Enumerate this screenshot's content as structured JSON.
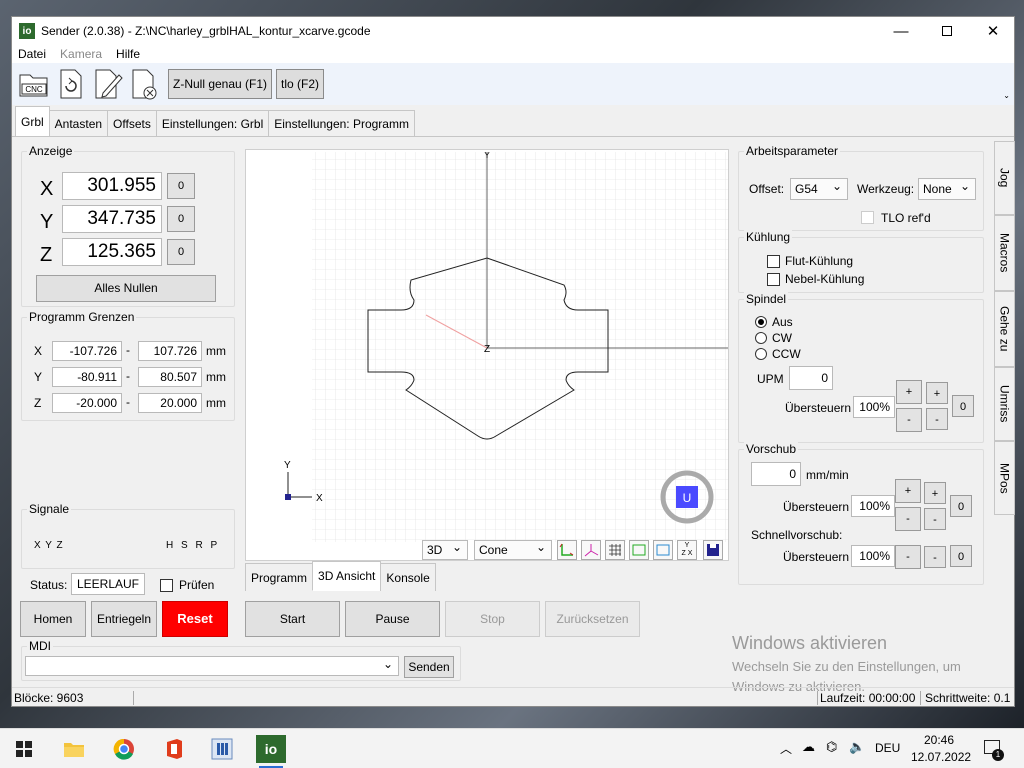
{
  "window": {
    "title": "Sender (2.0.38) - Z:\\NC\\harley_grblHAL_kontur_xcarve.gcode",
    "app_icon": "io"
  },
  "menu": {
    "items": [
      "Datei",
      "Kamera",
      "Hilfe"
    ]
  },
  "toolbar": {
    "zero_btn": "Z-Null genau (F1)",
    "tlo_btn": "tlo (F2)",
    "cnc_label": "CNC"
  },
  "tabs": [
    "Grbl",
    "Antasten",
    "Offsets",
    "Einstellungen: Grbl",
    "Einstellungen: Programm"
  ],
  "display": {
    "title": "Anzeige",
    "x_label": "X",
    "x_value": "301.955",
    "y_label": "Y",
    "y_value": "347.735",
    "z_label": "Z",
    "z_value": "125.365",
    "zero_btn": "0",
    "all_zero": "Alles Nullen"
  },
  "limits": {
    "title": "Programm Grenzen",
    "rows": [
      {
        "axis": "X",
        "min": "-107.726",
        "max": "107.726",
        "unit": "mm"
      },
      {
        "axis": "Y",
        "min": "-80.911",
        "max": "80.507",
        "unit": "mm"
      },
      {
        "axis": "Z",
        "min": "-20.000",
        "max": "20.000",
        "unit": "mm"
      }
    ],
    "dash": "-"
  },
  "signals": {
    "title": "Signale",
    "left": "X Y Z",
    "right": "H S R P"
  },
  "status": {
    "label": "Status:",
    "value": "LEERLAUF",
    "check_label": "Prüfen"
  },
  "buttons": {
    "home": "Homen",
    "unlock": "Entriegeln",
    "reset": "Reset",
    "start": "Start",
    "pause": "Pause",
    "stop": "Stop",
    "rewind": "Zurücksetzen"
  },
  "mdi": {
    "title": "MDI",
    "send": "Senden"
  },
  "view": {
    "mode": "3D",
    "tool_shape": "Cone",
    "axis_y": "Y",
    "axis_x": "X",
    "origin": "Z",
    "top_mark": "Y",
    "icon_yzx_top": "Y",
    "icon_yzx_bottom": "Z X",
    "bottom_tabs": [
      "Programm",
      "3D Ansicht",
      "Konsole"
    ],
    "widget": "U"
  },
  "work": {
    "title": "Arbeitsparameter",
    "offset_label": "Offset:",
    "offset_value": "G54",
    "tool_label": "Werkzeug:",
    "tool_value": "None",
    "tlo": "TLO ref'd"
  },
  "coolant": {
    "title": "Kühlung",
    "flood": "Flut-Kühlung",
    "mist": "Nebel-Kühlung"
  },
  "spindle": {
    "title": "Spindel",
    "off": "Aus",
    "cw": "CW",
    "ccw": "CCW",
    "rpm_label": "UPM",
    "rpm_value": "0",
    "override_label": "Übersteuern",
    "override_value": "100%",
    "plus": "+",
    "minus": "-",
    "zero": "0"
  },
  "feed": {
    "title": "Vorschub",
    "value": "0",
    "unit": "mm/min",
    "override_label": "Übersteuern",
    "override_value": "100%",
    "rapid_label": "Schnellvorschub:",
    "rapid_override_label": "Übersteuern",
    "rapid_value": "100%",
    "plus": "+",
    "minus": "-",
    "zero": "0"
  },
  "side_tabs": [
    "Jog",
    "Macros",
    "Gehe zu",
    "Umriss",
    "MPos"
  ],
  "statusbar": {
    "blocks": "Blöcke: 9603",
    "runtime": "Laufzeit: 00:00:00",
    "step": "Schrittweite: 0.1"
  },
  "watermark": {
    "title": "Windows aktivieren",
    "line1": "Wechseln Sie zu den Einstellungen, um",
    "line2": "Windows zu aktivieren."
  },
  "taskbar": {
    "lang": "DEU",
    "time": "20:46",
    "date": "12.07.2022",
    "io_app": "io",
    "notifications": "1"
  }
}
